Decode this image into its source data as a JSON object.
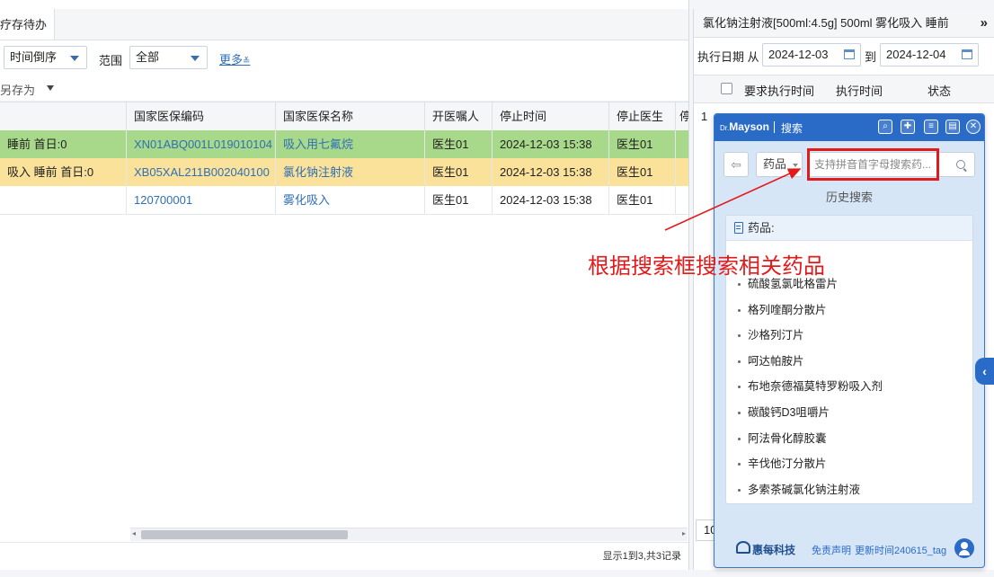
{
  "main": {
    "tab_label": "疗存待办",
    "filters": {
      "sort_value": "时间倒序",
      "range_label": "范围",
      "range_value": "全部",
      "more_label": "更多"
    },
    "toolbar": {
      "save_as_label": "另存为"
    },
    "columns": [
      "国家医保编码",
      "国家医保名称",
      "开医嘱人",
      "停止时间",
      "停止医生",
      "停"
    ],
    "rows": [
      {
        "prefix": "睡前  首日:0",
        "code": "XN01ABQ001L019010104",
        "name": "吸入用七氟烷",
        "doctor": "医生01",
        "stop_time": "2024-12-03 15:38",
        "stop_doctor": "医生01",
        "bg": "#a8d98a"
      },
      {
        "prefix": "吸入  睡前  首日:0",
        "code": "XB05XAL211B002040100",
        "name": "氯化钠注射液",
        "doctor": "医生01",
        "stop_time": "2024-12-03 15:38",
        "stop_doctor": "医生01",
        "bg": "#fbe29b"
      },
      {
        "prefix": "",
        "code": "120700001",
        "name": "雾化吸入",
        "doctor": "医生01",
        "stop_time": "2024-12-03 15:38",
        "stop_doctor": "医生01",
        "bg": "#ffffff"
      }
    ],
    "status_text": "显示1到3,共3记录"
  },
  "right_panel": {
    "title": "氯化钠注射液[500ml:4.5g] 500ml 雾化吸入 睡前",
    "date_label": "执行日期 从",
    "date_from": "2024-12-03",
    "to_label": "到",
    "date_to": "2024-12-04",
    "columns": [
      "要求执行时间",
      "执行时间",
      "状态"
    ],
    "row_index": "1",
    "page_index": "10"
  },
  "mayson": {
    "brand_prefix": "Dr.",
    "brand": "Mayson",
    "title": "搜索",
    "type_value": "药品",
    "search_placeholder": "支持拼音首字母搜索药...",
    "history_label": "历史搜索",
    "results_header": "药品:",
    "results": [
      "硫酸氢氯吡格雷片",
      "格列喹酮分散片",
      "沙格列汀片",
      "呵达帕胺片",
      "布地奈德福莫特罗粉吸入剂",
      "碳酸钙D3咀嚼片",
      "阿法骨化醇胶囊",
      "辛伐他汀分散片",
      "多索茶碱氯化钠注射液"
    ],
    "footer_logo": "惠每科技",
    "footer_disclaimer": "免责声明",
    "footer_update": "更新时间240615_tag"
  },
  "annotation": {
    "text": "根据搜索框搜索相关药品",
    "color": "#e31a1a"
  }
}
